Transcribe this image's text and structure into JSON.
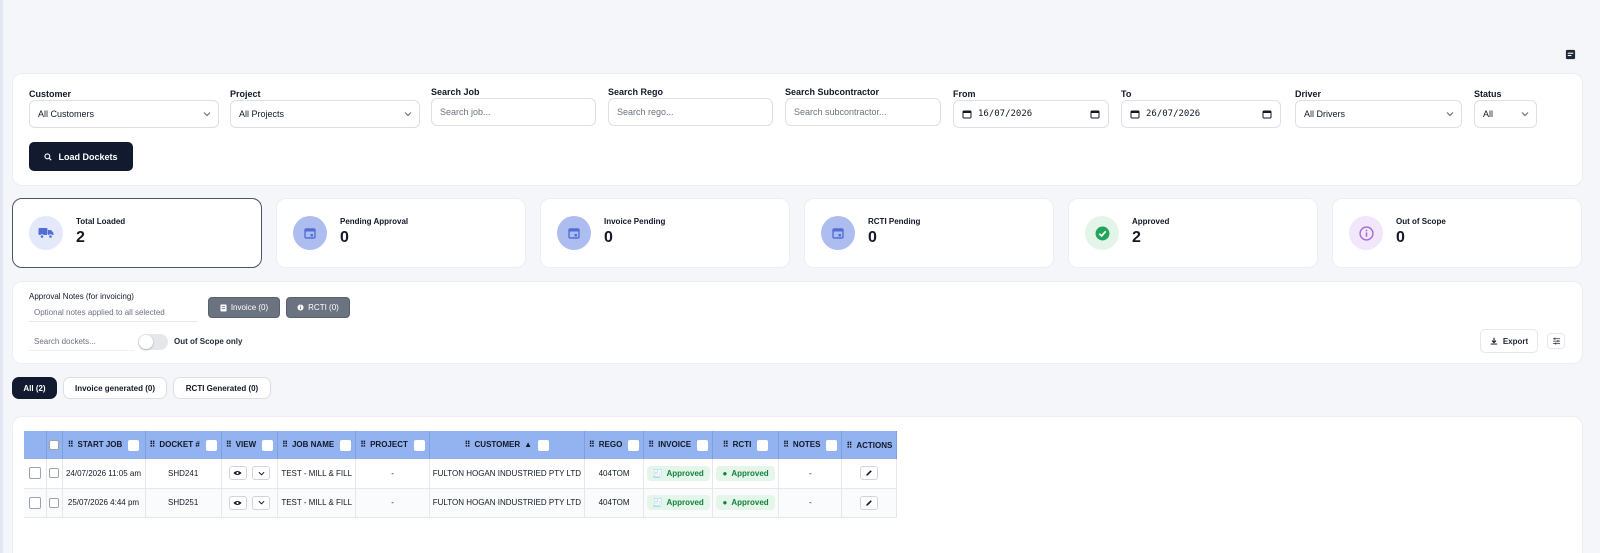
{
  "filters": {
    "customer": {
      "label": "Customer",
      "value": "All Customers"
    },
    "project": {
      "label": "Project",
      "value": "All Projects"
    },
    "search_job": {
      "label": "Search Job",
      "placeholder": "Search job..."
    },
    "search_rego": {
      "label": "Search Rego",
      "placeholder": "Search rego..."
    },
    "search_sub": {
      "label": "Search Subcontractor",
      "placeholder": "Search subcontractor..."
    },
    "from": {
      "label": "From",
      "value": "16/07/2026"
    },
    "to": {
      "label": "To",
      "value": "26/07/2026"
    },
    "driver": {
      "label": "Driver",
      "value": "All Drivers"
    },
    "status": {
      "label": "Status",
      "value": "All"
    },
    "load_button": "Load Dockets"
  },
  "stats": [
    {
      "label": "Total Loaded",
      "value": "2",
      "icon": "truck-icon",
      "color": "#4f6fd6"
    },
    {
      "label": "Pending Approval",
      "value": "0",
      "icon": "calendar-icon",
      "color": "#4f6fd6"
    },
    {
      "label": "Invoice Pending",
      "value": "0",
      "icon": "calendar-icon",
      "color": "#4f6fd6"
    },
    {
      "label": "RCTI Pending",
      "value": "0",
      "icon": "calendar-icon",
      "color": "#4f6fd6"
    },
    {
      "label": "Approved",
      "value": "2",
      "icon": "check-circle-icon",
      "color": "#22a55a"
    },
    {
      "label": "Out of Scope",
      "value": "0",
      "icon": "info-circle-icon",
      "color": "#a26ad6"
    }
  ],
  "approval": {
    "notes_label": "Approval Notes (for invoicing)",
    "notes_placeholder": "Optional notes applied to all selected",
    "invoice_button": "Invoice (0)",
    "rcti_button": "RCTI (0)",
    "search_placeholder": "Search dockets...",
    "toggle_label": "Out of Scope only",
    "export_button": "Export"
  },
  "tabs": [
    "All (2)",
    "Invoice generated (0)",
    "RCTI Generated (0)"
  ],
  "table": {
    "columns": [
      "START JOB",
      "DOCKET #",
      "VIEW",
      "JOB NAME",
      "PROJECT",
      "CUSTOMER",
      "REGO",
      "INVOICE",
      "RCTI",
      "NOTES",
      "ACTIONS"
    ],
    "sort_arrow": "▲",
    "rows": [
      {
        "start": "24/07/2026 11:05 am",
        "docket": "SHD241",
        "job": "TEST - MILL & FILL",
        "project": "-",
        "customer": "FULTON HOGAN INDUSTRIED PTY LTD",
        "rego": "404TOM",
        "invoice": "Approved",
        "rcti": "Approved",
        "notes": "-"
      },
      {
        "start": "25/07/2026 4:44 pm",
        "docket": "SHD251",
        "job": "TEST - MILL & FILL",
        "project": "-",
        "customer": "FULTON HOGAN INDUSTRIED PTY LTD",
        "rego": "404TOM",
        "invoice": "Approved",
        "rcti": "Approved",
        "notes": "-"
      }
    ]
  }
}
